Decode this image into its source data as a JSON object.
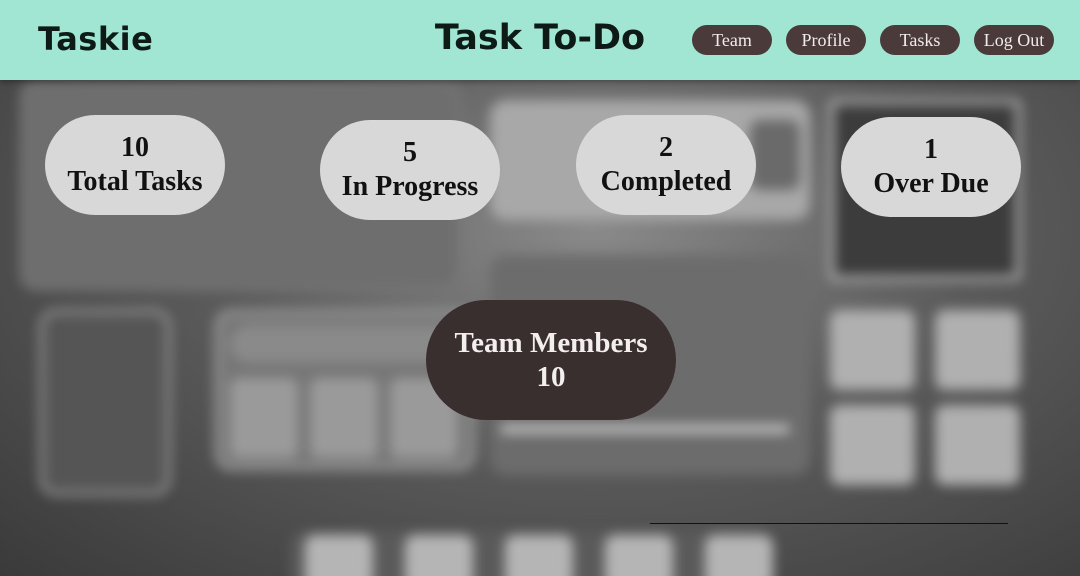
{
  "header": {
    "logo": "Taskie",
    "title": "Task To-Do",
    "nav": {
      "team": "Team",
      "profile": "Profile",
      "tasks": "Tasks",
      "logout": "Log Out"
    }
  },
  "stats": {
    "total": {
      "value": "10",
      "label": "Total Tasks"
    },
    "in_progress": {
      "value": "5",
      "label": "In Progress"
    },
    "completed": {
      "value": "2",
      "label": "Completed"
    },
    "overdue": {
      "value": "1",
      "label": "Over Due"
    }
  },
  "team": {
    "label": "Team Members",
    "count": "10"
  },
  "colors": {
    "header_bg": "#a0e6d2",
    "nav_button_bg": "#4a3a3a",
    "stat_pill_bg": "#d8d8d8",
    "team_pill_bg": "#3a2f2f"
  }
}
